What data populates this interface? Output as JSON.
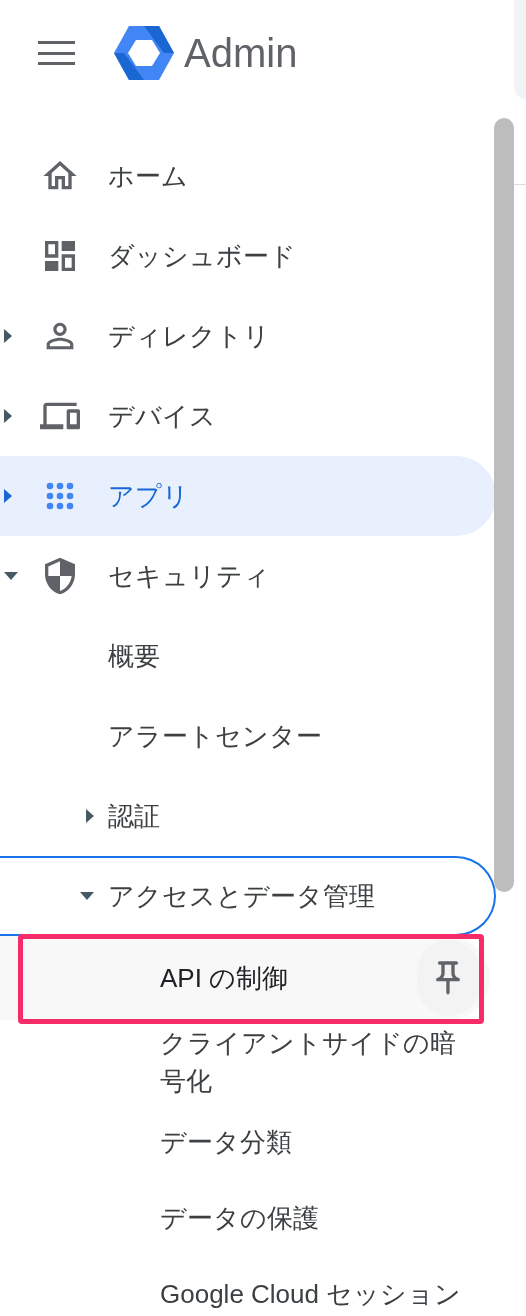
{
  "header": {
    "title": "Admin"
  },
  "nav": [
    {
      "label": "ホーム",
      "kind": "leaf",
      "selected": false
    },
    {
      "label": "ダッシュボード",
      "kind": "leaf",
      "selected": false
    },
    {
      "label": "ディレクトリ",
      "kind": "group",
      "expanded": false,
      "selected": false
    },
    {
      "label": "デバイス",
      "kind": "group",
      "expanded": false,
      "selected": false
    },
    {
      "label": "アプリ",
      "kind": "group",
      "expanded": false,
      "selected": true
    },
    {
      "label": "セキュリティ",
      "kind": "group",
      "expanded": true,
      "selected": false,
      "children": [
        {
          "label": "概要",
          "kind": "leaf",
          "selected": false,
          "focused": false
        },
        {
          "label": "アラートセンター",
          "kind": "leaf",
          "selected": false,
          "focused": false
        },
        {
          "label": "認証",
          "kind": "group",
          "expanded": false,
          "selected": false,
          "focused": false
        },
        {
          "label": "アクセスとデータ管理",
          "kind": "group",
          "expanded": true,
          "selected": false,
          "focused": true,
          "children": [
            {
              "label": "API の制御",
              "selected": false,
              "hovered": true,
              "annotated": true
            },
            {
              "label": "クライアントサイドの暗号化",
              "selected": false,
              "hovered": false,
              "annotated": false
            },
            {
              "label": "データ分類",
              "selected": false,
              "hovered": false,
              "annotated": false
            },
            {
              "label": "データの保護",
              "selected": false,
              "hovered": false,
              "annotated": false
            },
            {
              "label": "Google Cloud セッション",
              "selected": false,
              "hovered": false,
              "annotated": false
            }
          ]
        }
      ]
    }
  ]
}
